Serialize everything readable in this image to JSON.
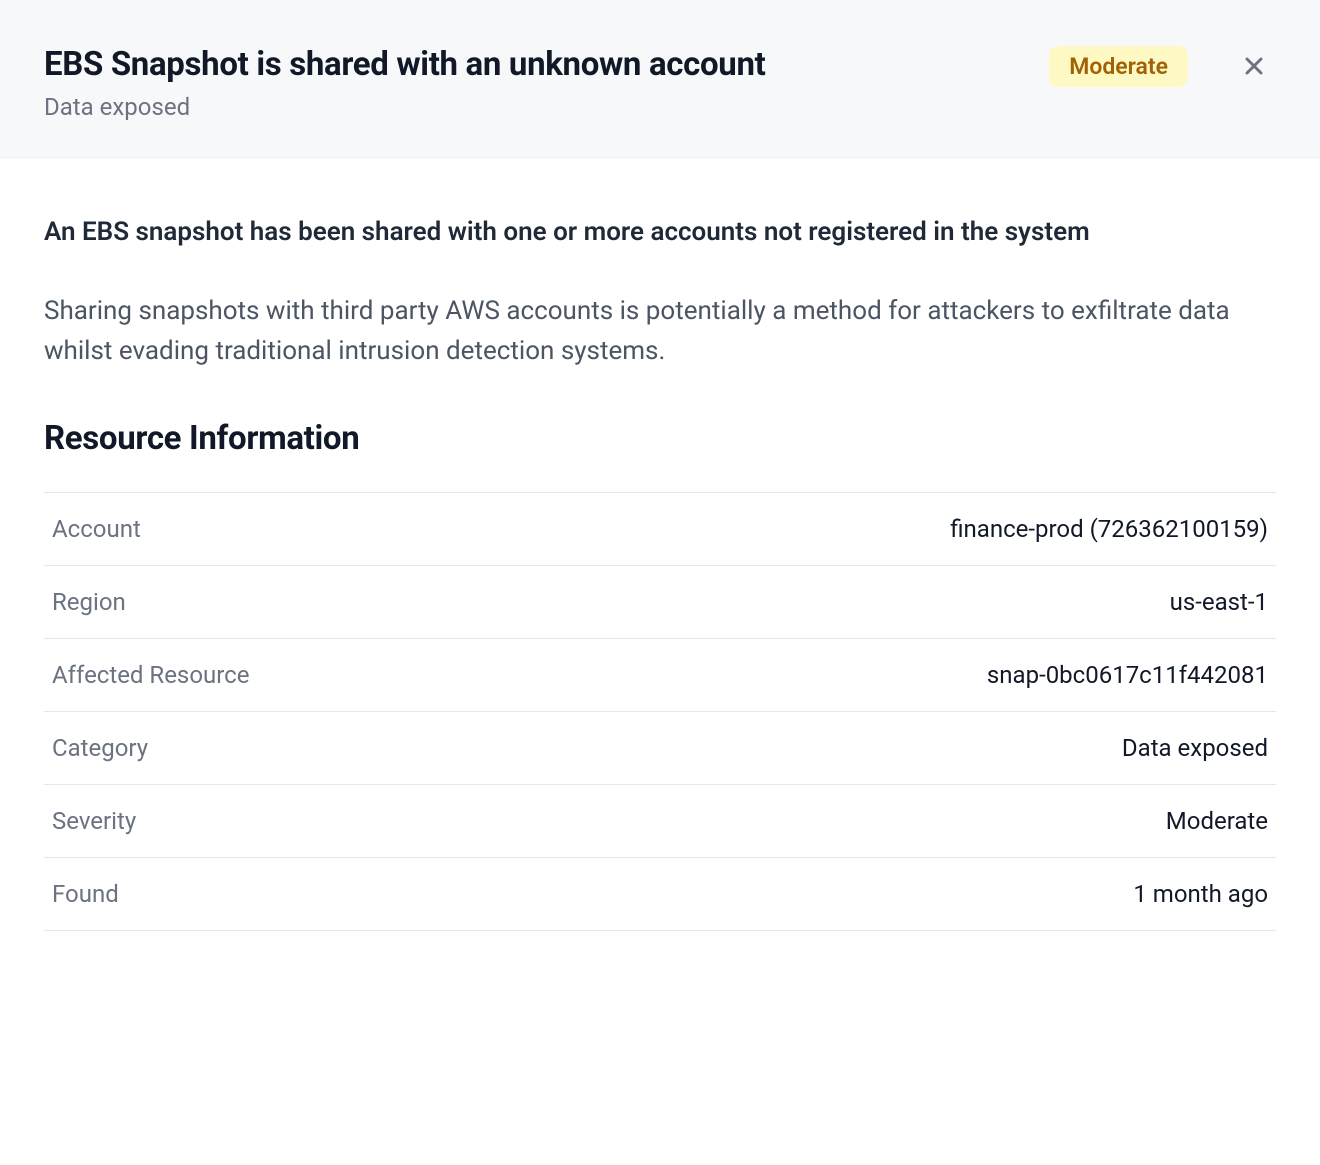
{
  "header": {
    "title": "EBS Snapshot is shared with an unknown account",
    "subtitle": "Data exposed",
    "badge": "Moderate"
  },
  "content": {
    "summary": "An EBS snapshot has been shared with one or more accounts not registered in the system",
    "description": "Sharing snapshots with third party AWS accounts is potentially a method for attackers to exfiltrate data whilst evading traditional intrusion detection systems."
  },
  "section": {
    "title": "Resource Information",
    "rows": [
      {
        "label": "Account",
        "value": "finance-prod (726362100159)"
      },
      {
        "label": "Region",
        "value": "us-east-1"
      },
      {
        "label": "Affected Resource",
        "value": "snap-0bc0617c11f442081"
      },
      {
        "label": "Category",
        "value": "Data exposed"
      },
      {
        "label": "Severity",
        "value": "Moderate"
      },
      {
        "label": "Found",
        "value": "1 month ago"
      }
    ]
  },
  "colors": {
    "badge_bg": "#fef9c3",
    "badge_fg": "#a16207"
  }
}
